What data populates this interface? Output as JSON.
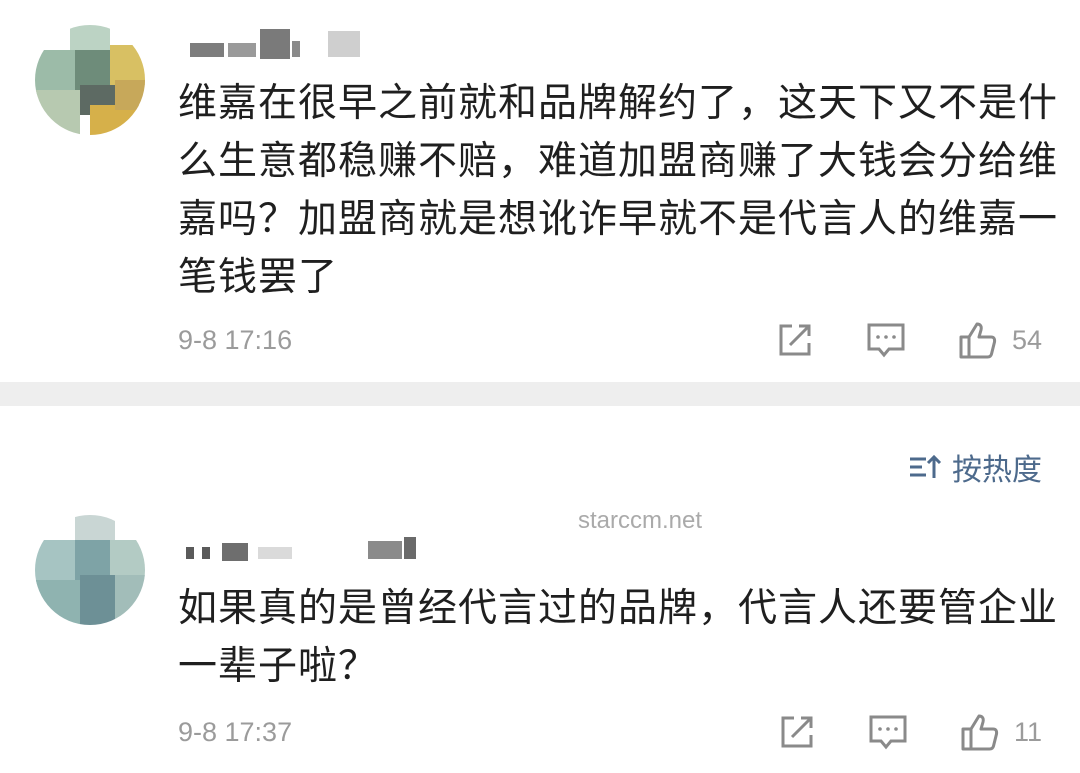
{
  "comments": [
    {
      "text": "维嘉在很早之前就和品牌解约了，这天下又不是什么生意都稳赚不赔，难道加盟商赚了大钱会分给维嘉吗？加盟商就是想讹诈早就不是代言人的维嘉一笔钱罢了",
      "time": "9-8 17:16",
      "likes": "54",
      "actions": [
        "share-icon",
        "comment-icon",
        "thumbs-up-icon"
      ]
    },
    {
      "text": "如果真的是曾经代言过的品牌，代言人还要管企业一辈子啦？",
      "time": "9-8 17:37",
      "likes": "11",
      "actions": [
        "share-icon",
        "comment-icon",
        "thumbs-up-icon"
      ]
    }
  ],
  "sort": {
    "label": "按热度",
    "icon": "sort-icon"
  },
  "watermark": "starccm.net",
  "colors": {
    "text": "#1f1f1f",
    "meta": "#9b9b9b",
    "accent": "#4d6a8c",
    "divider": "#eeeeee"
  }
}
